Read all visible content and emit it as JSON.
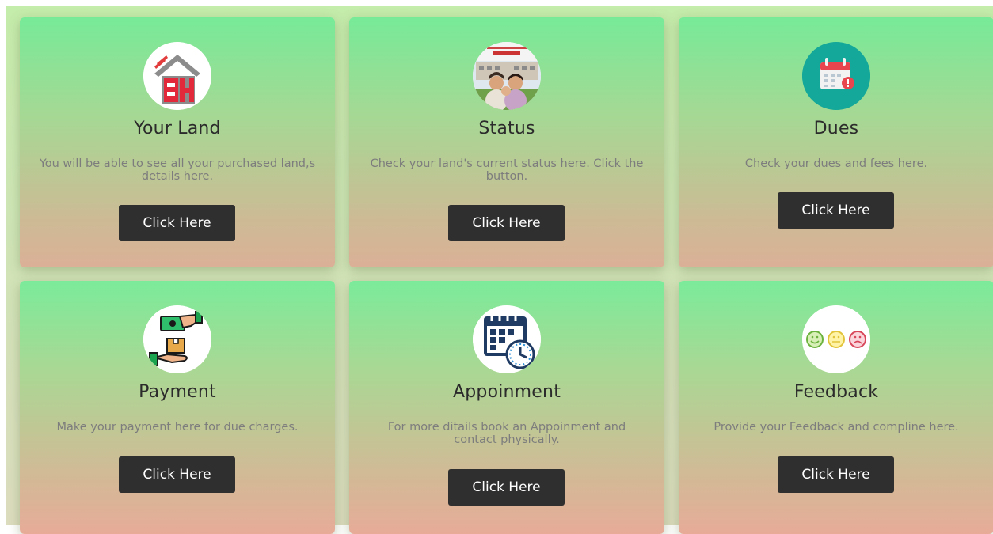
{
  "cards": [
    {
      "title": "Your Land",
      "description": "You will be able to see all your purchased land,s details here.",
      "button_label": "Click Here",
      "icon": "house-logo-icon"
    },
    {
      "title": "Status",
      "description": "Check your land's current status here. Click the button.",
      "button_label": "Click Here",
      "icon": "family-photo-icon"
    },
    {
      "title": "Dues",
      "description": "Check your dues and fees here.",
      "button_label": "Click Here",
      "icon": "calendar-alert-icon"
    },
    {
      "title": "Payment",
      "description": "Make your payment here for due charges.",
      "button_label": "Click Here",
      "icon": "cash-hand-icon"
    },
    {
      "title": "Appoinment",
      "description": "For more ditails book an Appoinment and contact physically.",
      "button_label": "Click Here",
      "icon": "calendar-clock-icon"
    },
    {
      "title": "Feedback",
      "description": "Provide your Feedback and compline here.",
      "button_label": "Click Here",
      "icon": "smiley-faces-icon"
    }
  ],
  "colors": {
    "card_top": "#77ea98",
    "card_bottom": "#dbb097",
    "button_bg": "#2f2f2f",
    "button_text": "#ffffff",
    "title_text": "#2b2b2b",
    "desc_text": "#7d7d7d"
  }
}
